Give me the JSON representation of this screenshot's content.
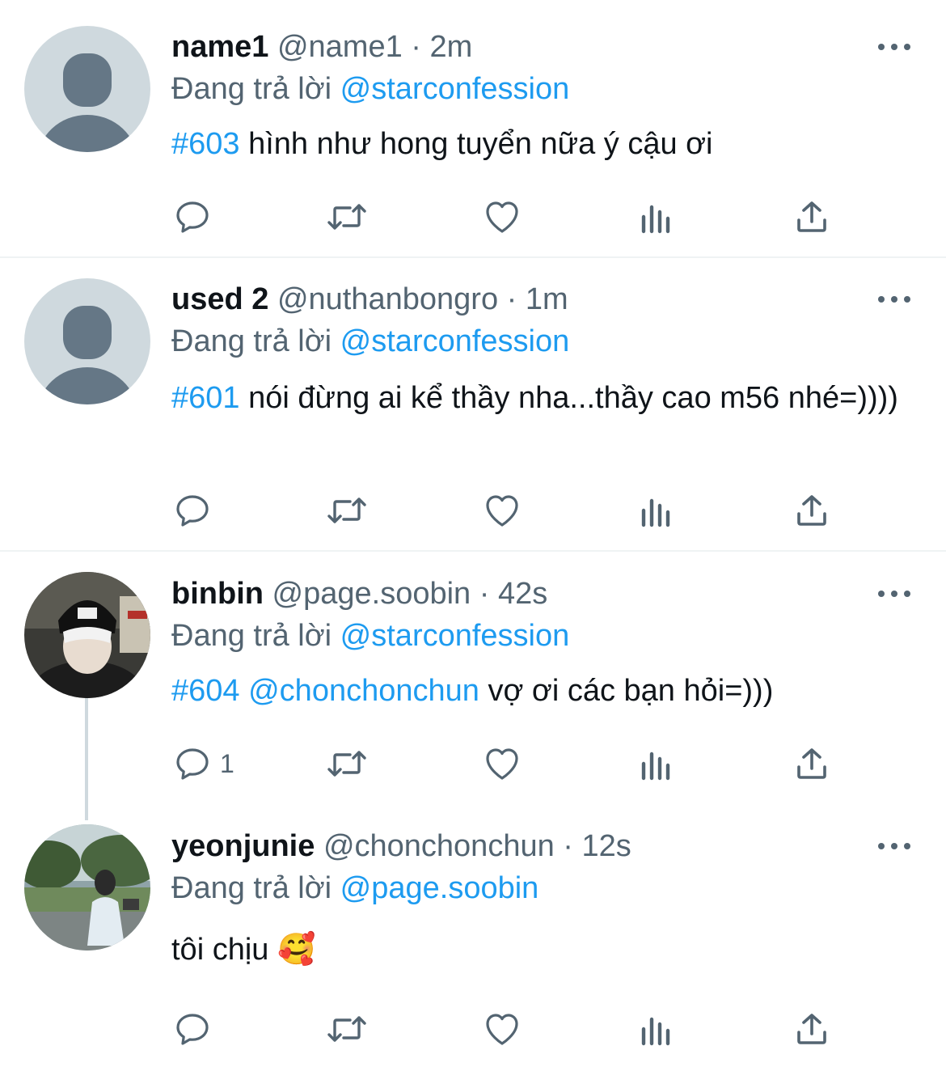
{
  "tweets": [
    {
      "name": "name1",
      "handle": "@name1",
      "separator": "·",
      "time": "2m",
      "replying_prefix": "Đang trả lời",
      "replying_to": "@starconfession",
      "hashtag": "#603",
      "mention": "",
      "text": " hình như hong tuyển nữa ý cậu ơi",
      "reply_count": ""
    },
    {
      "name": "used 2",
      "handle": "@nuthanbongro",
      "separator": "·",
      "time": "1m",
      "replying_prefix": "Đang trả lời",
      "replying_to": "@starconfession",
      "hashtag": "#601",
      "mention": "",
      "text": " nói đừng ai kể thầy nha...thầy cao m56 nhé=))))",
      "reply_count": ""
    },
    {
      "name": "binbin",
      "handle": "@page.soobin",
      "separator": "·",
      "time": "42s",
      "replying_prefix": "Đang trả lời",
      "replying_to": "@starconfession",
      "hashtag": "#604",
      "mention": " @chonchonchun",
      "text": " vợ ơi các bạn hỏi=)))",
      "reply_count": "1"
    },
    {
      "name": "yeonjunie",
      "handle": "@chonchonchun",
      "separator": "·",
      "time": "12s",
      "replying_prefix": "Đang trả lời",
      "replying_to": "@page.soobin",
      "hashtag": "",
      "mention": "",
      "text": "tôi chịu 🥰",
      "reply_count": ""
    }
  ],
  "colors": {
    "accent": "#1d9bf0",
    "secondary_text": "#536471",
    "divider": "#eff3f4",
    "thread_line": "#cfd9de",
    "default_avatar_bg": "#cfd9de",
    "default_avatar_fg": "#657786"
  },
  "icons": [
    "reply-icon",
    "retweet-icon",
    "like-icon",
    "views-icon",
    "share-icon",
    "more-icon"
  ]
}
